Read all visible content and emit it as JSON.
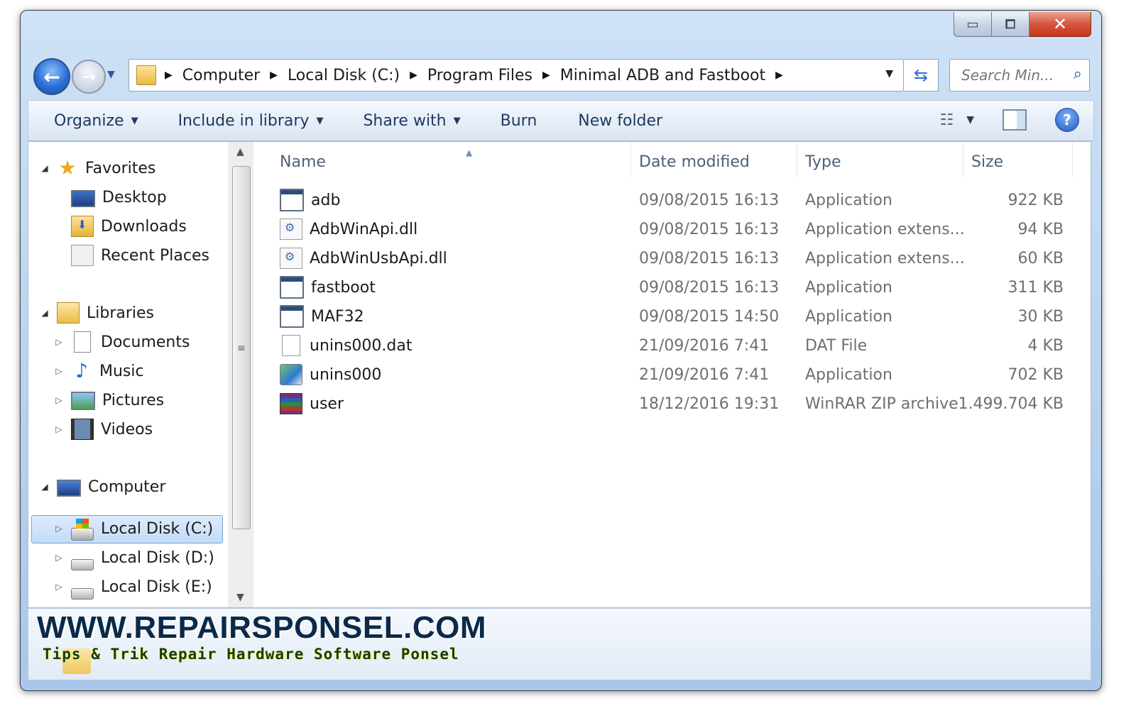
{
  "window": {
    "caption": {
      "minimize_glyph": "▭",
      "maximize_glyph": "⧠",
      "close_glyph": "✕"
    }
  },
  "navigation": {
    "breadcrumb": [
      "Computer",
      "Local Disk (C:)",
      "Program Files",
      "Minimal ADB and Fastboot"
    ],
    "search_placeholder": "Search Min..."
  },
  "toolbar": {
    "organize": "Organize",
    "include_in_library": "Include in library",
    "share_with": "Share with",
    "burn": "Burn",
    "new_folder": "New folder"
  },
  "navpane": {
    "favorites": {
      "label": "Favorites",
      "items": [
        "Desktop",
        "Downloads",
        "Recent Places"
      ]
    },
    "libraries": {
      "label": "Libraries",
      "items": [
        "Documents",
        "Music",
        "Pictures",
        "Videos"
      ]
    },
    "computer": {
      "label": "Computer",
      "items": [
        "Local Disk (C:)",
        "Local Disk (D:)",
        "Local Disk (E:)"
      ],
      "selected": "Local Disk (C:)"
    }
  },
  "filelist": {
    "columns": {
      "name": "Name",
      "date": "Date modified",
      "type": "Type",
      "size": "Size"
    },
    "sorted_by": "Name",
    "rows": [
      {
        "name": "adb",
        "date": "09/08/2015 16:13",
        "type": "Application",
        "size": "922 KB",
        "icon": "application-icon"
      },
      {
        "name": "AdbWinApi.dll",
        "date": "09/08/2015 16:13",
        "type": "Application extens...",
        "size": "94 KB",
        "icon": "dll-icon"
      },
      {
        "name": "AdbWinUsbApi.dll",
        "date": "09/08/2015 16:13",
        "type": "Application extens...",
        "size": "60 KB",
        "icon": "dll-icon"
      },
      {
        "name": "fastboot",
        "date": "09/08/2015 16:13",
        "type": "Application",
        "size": "311 KB",
        "icon": "application-icon"
      },
      {
        "name": "MAF32",
        "date": "09/08/2015 14:50",
        "type": "Application",
        "size": "30 KB",
        "icon": "application-icon"
      },
      {
        "name": "unins000.dat",
        "date": "21/09/2016 7:41",
        "type": "DAT File",
        "size": "4 KB",
        "icon": "blank-file-icon"
      },
      {
        "name": "unins000",
        "date": "21/09/2016 7:41",
        "type": "Application",
        "size": "702 KB",
        "icon": "setup-icon"
      },
      {
        "name": "user",
        "date": "18/12/2016 19:31",
        "type": "WinRAR ZIP archive",
        "size": "1.499.704 KB",
        "icon": "winrar-archive-icon"
      }
    ]
  },
  "watermark": {
    "title": "WWW.REPAIRSPONSEL.COM",
    "subtitle": "Tips & Trik Repair Hardware Software Ponsel"
  }
}
